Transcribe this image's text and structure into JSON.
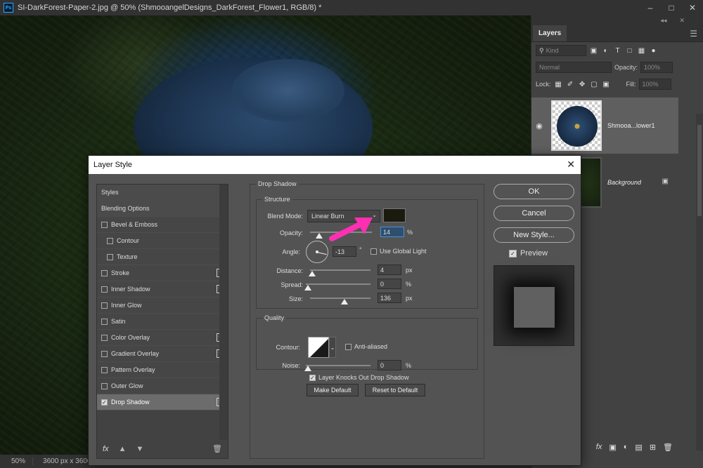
{
  "window": {
    "app_logo": "Ps",
    "title": "SI-DarkForest-Paper-2.jpg @ 50% (ShmooangelDesigns_DarkForest_Flower1, RGB/8) *",
    "controls": [
      "minimize-icon",
      "restore-icon",
      "close-icon"
    ]
  },
  "statusbar": {
    "zoom": "50%",
    "doc_size": "3600 px x 3600"
  },
  "layers_panel": {
    "tab": "Layers",
    "kind_placeholder": "Kind",
    "blend_mode": "Normal",
    "opacity_label": "Opacity:",
    "opacity_value": "100%",
    "lock_label": "Lock:",
    "fill_label": "Fill:",
    "fill_value": "100%",
    "layers": [
      {
        "name": "Shmooa...lower1",
        "has_fx": true,
        "fx_label": "fx"
      },
      {
        "name": "Background",
        "locked": true
      }
    ]
  },
  "layer_style": {
    "title": "Layer Style",
    "styles": [
      {
        "label": "Styles",
        "type": "header"
      },
      {
        "label": "Blending Options",
        "type": "header"
      },
      {
        "label": "Bevel & Emboss",
        "checked": false
      },
      {
        "label": "Contour",
        "checked": false,
        "indent": true
      },
      {
        "label": "Texture",
        "checked": false,
        "indent": true
      },
      {
        "label": "Stroke",
        "checked": false,
        "plus": true
      },
      {
        "label": "Inner Shadow",
        "checked": false,
        "plus": true
      },
      {
        "label": "Inner Glow",
        "checked": false
      },
      {
        "label": "Satin",
        "checked": false
      },
      {
        "label": "Color Overlay",
        "checked": false,
        "plus": true
      },
      {
        "label": "Gradient Overlay",
        "checked": false,
        "plus": true
      },
      {
        "label": "Pattern Overlay",
        "checked": false
      },
      {
        "label": "Outer Glow",
        "checked": false
      },
      {
        "label": "Drop Shadow",
        "checked": true,
        "plus": true,
        "selected": true
      }
    ],
    "fx_label": "fx",
    "drop_shadow": {
      "group_title": "Drop Shadow",
      "structure_title": "Structure",
      "blend_mode_label": "Blend Mode:",
      "blend_mode": "Linear Burn",
      "shadow_color": "#1b1a0f",
      "opacity_label": "Opacity:",
      "opacity": "14",
      "opacity_unit": "%",
      "opacity_fraction": 0.14,
      "angle_label": "Angle:",
      "angle": "-13",
      "angle_unit": "°",
      "use_global_light_label": "Use Global Light",
      "use_global_light": false,
      "distance_label": "Distance:",
      "distance": "4",
      "distance_unit": "px",
      "spread_label": "Spread:",
      "spread": "0",
      "spread_unit": "%",
      "size_label": "Size:",
      "size": "136",
      "size_unit": "px",
      "quality_title": "Quality",
      "contour_label": "Contour:",
      "anti_aliased_label": "Anti-aliased",
      "anti_aliased": false,
      "noise_label": "Noise:",
      "noise": "0",
      "noise_unit": "%",
      "knocks_out_label": "Layer Knocks Out Drop Shadow",
      "knocks_out": true,
      "make_default_label": "Make Default",
      "reset_default_label": "Reset to Default"
    },
    "ok_label": "OK",
    "cancel_label": "Cancel",
    "new_style_label": "New Style...",
    "preview_label": "Preview",
    "preview_checked": true
  },
  "annotation": {
    "arrow_color": "#ff2fb4"
  }
}
